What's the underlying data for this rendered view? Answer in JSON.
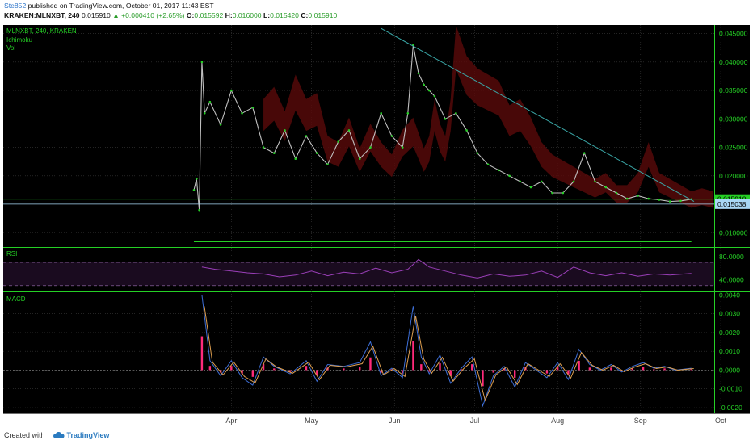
{
  "header": {
    "author": "Ste852",
    "published": " published on TradingView.com, October 01, 2017 11:43 EST",
    "symbol": "KRAKEN:MLNXBT, 240",
    "last": "0.015910",
    "change": "+0.000410 (+2.65%)",
    "o_label": "O:",
    "o": "0.015592",
    "h_label": "H:",
    "h": "0.016000",
    "l_label": "L:",
    "l": "0.015420",
    "c_label": "C:",
    "c": "0.015910"
  },
  "footer": {
    "created_with": "Created with",
    "brand": "TradingView"
  },
  "colors": {
    "background": "#000000",
    "grid": "#3a3a3a",
    "axis_text": "#25d025",
    "price_up": "#25d025",
    "price_down": "#c0c0c0",
    "cloud": "#5a0a0a",
    "trendline": "#3aa7a7",
    "rsi": "#9a3fb8",
    "macd_line": "#3d6ed6",
    "signal_line": "#e0a050",
    "histogram": "#ff2a7a",
    "badge_green": "#25d025",
    "badge_blue": "#a9d7f5"
  },
  "chart_data": [
    {
      "type": "line",
      "title": "MLNXBT, 240, KRAKEN",
      "indicator_labels": [
        "Ichimoku",
        "Vol"
      ],
      "x_tick_labels": [
        "Apr",
        "May",
        "Jun",
        "Jul",
        "Aug",
        "Sep",
        "Oct"
      ],
      "ylim": [
        0.0075,
        0.0465
      ],
      "y_tick_labels": [
        "0.045000",
        "0.040000",
        "0.035000",
        "0.030000",
        "0.025000",
        "0.020000",
        "0.010000"
      ],
      "y_ticks": [
        0.045,
        0.04,
        0.035,
        0.03,
        0.025,
        0.02,
        0.01
      ],
      "last_price_badge": "0.015910",
      "last_price": 0.01591,
      "horizontal_level_badge": "0.015038",
      "horizontal_level": 0.015038,
      "trendline": {
        "from": [
          "Jun",
          0.0459
        ],
        "to": [
          "Oct",
          0.0155
        ]
      },
      "series": [
        {
          "x_day": [
            0,
            1,
            2,
            3,
            4,
            6,
            10,
            14,
            18,
            22,
            26,
            30,
            34,
            38,
            42,
            46,
            50,
            54,
            58,
            62,
            66,
            70,
            74,
            78,
            80,
            82,
            84,
            86,
            88,
            90,
            94,
            98,
            102,
            106,
            110,
            114,
            118,
            122,
            126,
            130,
            134,
            138,
            142,
            146,
            150,
            154,
            158,
            162,
            166,
            170,
            174,
            178,
            182,
            186
          ],
          "values": [
            0.0175,
            0.0195,
            0.014,
            0.04,
            0.031,
            0.033,
            0.029,
            0.035,
            0.031,
            0.032,
            0.025,
            0.024,
            0.028,
            0.023,
            0.027,
            0.024,
            0.022,
            0.026,
            0.028,
            0.023,
            0.025,
            0.031,
            0.027,
            0.025,
            0.031,
            0.043,
            0.038,
            0.036,
            0.035,
            0.034,
            0.03,
            0.031,
            0.028,
            0.024,
            0.022,
            0.021,
            0.02,
            0.019,
            0.018,
            0.019,
            0.017,
            0.017,
            0.019,
            0.024,
            0.019,
            0.018,
            0.017,
            0.016,
            0.0165,
            0.016,
            0.0158,
            0.0155,
            0.0156,
            0.0159
          ]
        }
      ]
    },
    {
      "type": "line",
      "title": "RSI",
      "ylim": [
        20,
        95
      ],
      "y_tick_labels": [
        "80.0000",
        "40.0000"
      ],
      "y_ticks": [
        80,
        40
      ],
      "bands": [
        70,
        30
      ],
      "series": [
        {
          "x_day": [
            3,
            8,
            14,
            20,
            26,
            32,
            38,
            44,
            50,
            56,
            62,
            68,
            74,
            80,
            84,
            88,
            94,
            100,
            106,
            112,
            118,
            124,
            130,
            136,
            142,
            148,
            154,
            160,
            166,
            172,
            178,
            186
          ],
          "values": [
            62,
            58,
            55,
            52,
            50,
            45,
            48,
            55,
            47,
            53,
            50,
            60,
            52,
            58,
            75,
            62,
            55,
            48,
            43,
            50,
            46,
            48,
            55,
            44,
            62,
            52,
            47,
            52,
            46,
            50,
            48,
            51
          ]
        }
      ]
    },
    {
      "type": "line",
      "title": "MACD",
      "ylim": [
        -0.0023,
        0.0041
      ],
      "y_tick_labels": [
        "0.0040",
        "0.0030",
        "0.0020",
        "0.0010",
        "0.0000",
        "-0.0010",
        "-0.0020"
      ],
      "y_ticks": [
        0.004,
        0.003,
        0.002,
        0.001,
        0.0,
        -0.001,
        -0.002
      ],
      "series": [
        {
          "x_day": [
            3,
            6,
            10,
            14,
            18,
            22,
            26,
            30,
            36,
            42,
            46,
            50,
            56,
            62,
            66,
            70,
            74,
            78,
            82,
            85,
            88,
            92,
            96,
            100,
            104,
            108,
            112,
            116,
            120,
            124,
            128,
            132,
            136,
            140,
            144,
            148,
            152,
            156,
            160,
            164,
            168,
            172,
            176,
            180,
            186
          ],
          "values": [
            0.004,
            0.0005,
            -0.0003,
            0.0005,
            -0.0004,
            -0.0008,
            0.0007,
            0.0002,
            -0.0002,
            0.0005,
            -0.0006,
            0.0003,
            0.0002,
            0.0004,
            0.0015,
            -0.0003,
            0.0001,
            -0.0004,
            0.0034,
            0.0007,
            -0.0002,
            0.0008,
            -0.0007,
            0.0001,
            0.0007,
            -0.0019,
            -0.0003,
            0.0002,
            -0.0009,
            0.0004,
            0.0,
            -0.0004,
            0.0004,
            -0.0005,
            0.0011,
            0.0003,
            0.0,
            0.0003,
            -0.0001,
            0.0002,
            0.0004,
            0.0001,
            0.0002,
            0.0,
            0.0001
          ]
        }
      ]
    }
  ]
}
